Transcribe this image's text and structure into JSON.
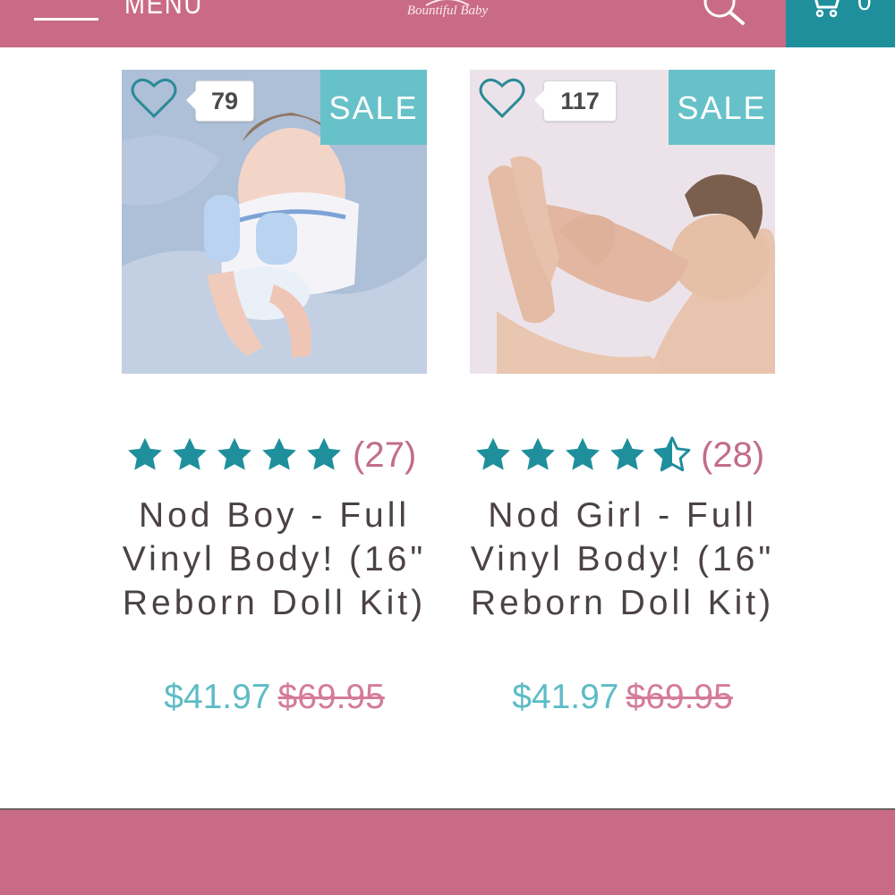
{
  "header": {
    "menu_label": "MENU",
    "logo_text": "Bountiful Baby",
    "cart_count": "0"
  },
  "colors": {
    "header_pink": "#c96b87",
    "cart_teal": "#1f8f9c",
    "sale_teal": "#67c1c9",
    "star_teal": "#1f8f9c",
    "review_pink": "#c26d8a",
    "price_teal": "#5dbcc6",
    "old_price_pink": "#d57b9a"
  },
  "products": [
    {
      "like_count": "79",
      "badge": "SALE",
      "rating": 5,
      "review_count": "(27)",
      "title": "Nod Boy - Full Vinyl Body! (16\" Reborn Doll Kit)",
      "price": "$41.97",
      "old_price": "$69.95"
    },
    {
      "like_count": "117",
      "badge": "SALE",
      "rating": 4.5,
      "review_count": "(28)",
      "title": "Nod Girl - Full Vinyl Body! (16\" Reborn Doll Kit)",
      "price": "$41.97",
      "old_price": "$69.95"
    }
  ]
}
